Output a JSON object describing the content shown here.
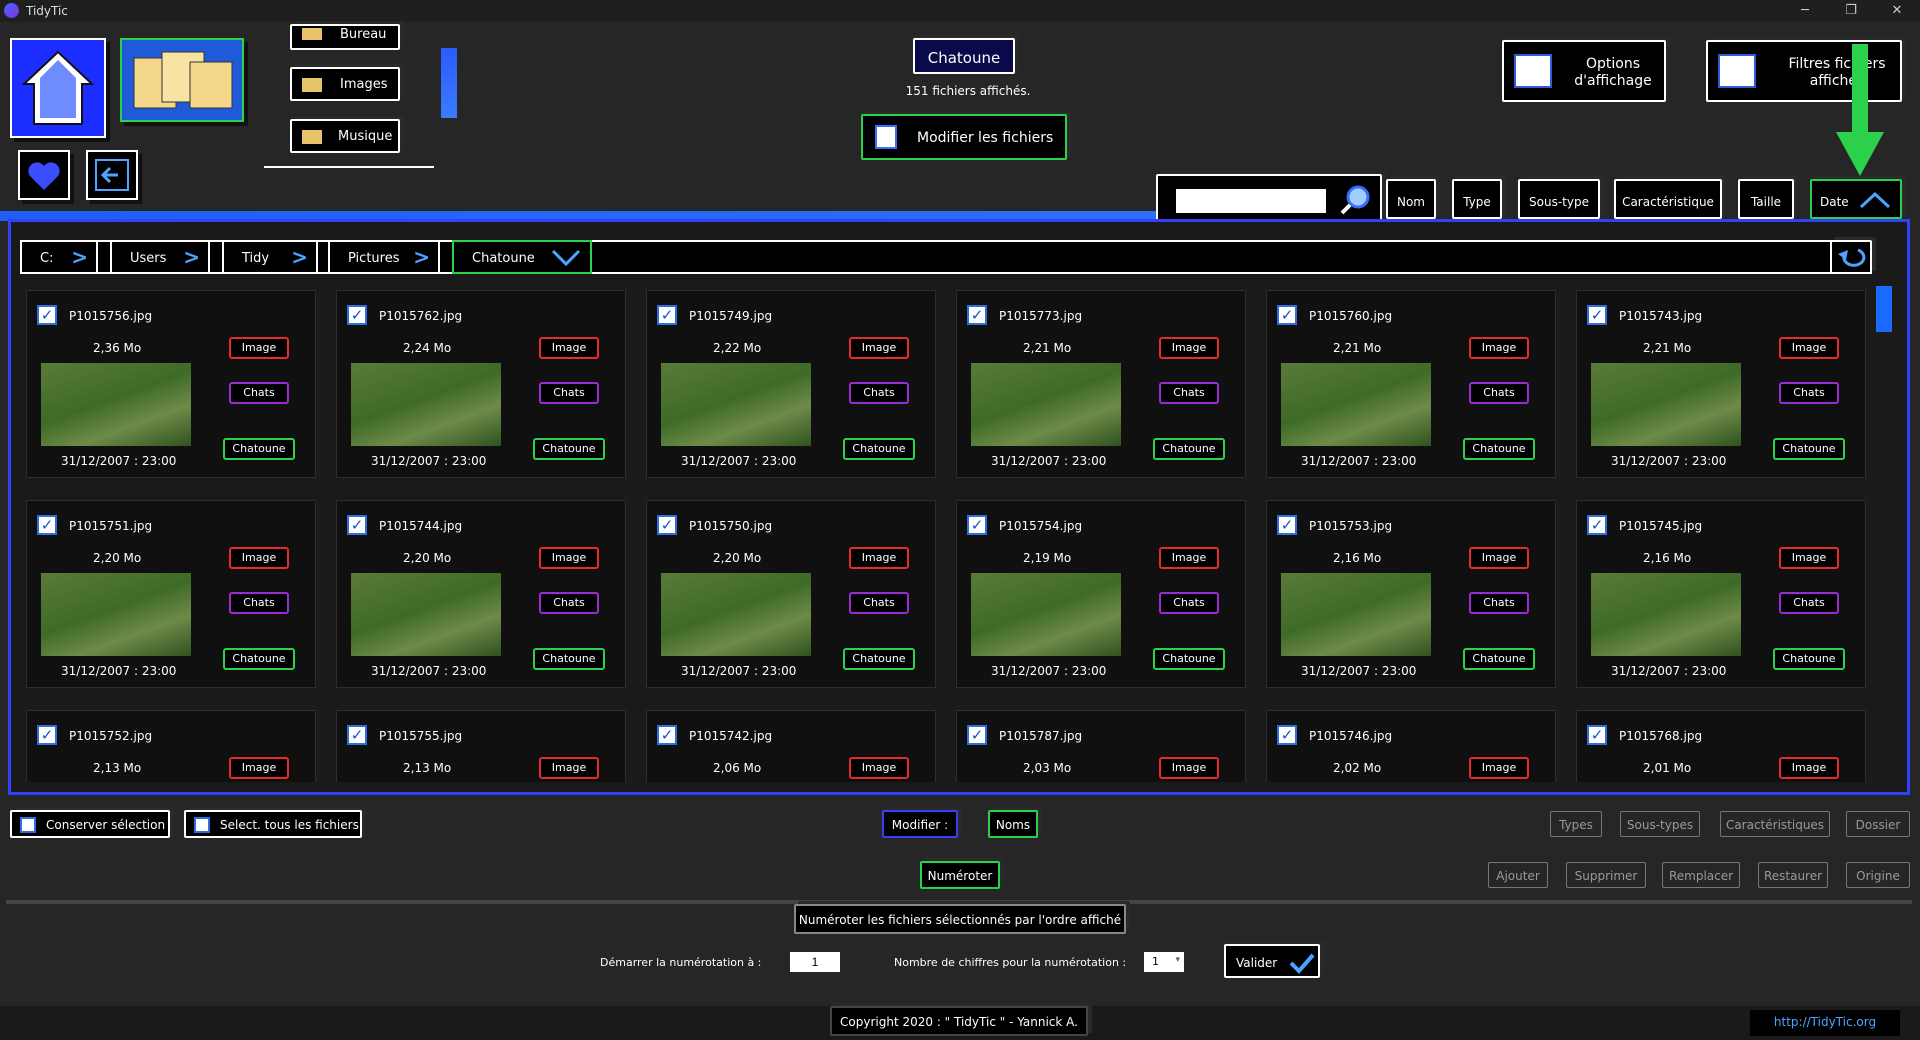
{
  "app": {
    "title": "TidyTic",
    "win_min": "─",
    "win_max": "❐",
    "win_close": "✕"
  },
  "favorites": [
    "Bureau",
    "Images",
    "Musique"
  ],
  "current": {
    "name": "Chatoune",
    "count_text": "151 fichiers affichés.",
    "modify_label": "Modifier les fichiers"
  },
  "options": {
    "display": "Options d'affichage",
    "filters": "Filtres fichiers affichés"
  },
  "sort": {
    "search_value": "",
    "labels": [
      "Nom",
      "Type",
      "Sous-type",
      "Caractéristique",
      "Taille",
      "Date"
    ]
  },
  "breadcrumb": [
    "C:",
    "Users",
    "Tidy",
    "Pictures",
    "Chatoune"
  ],
  "files": [
    {
      "name": "P1015756.jpg",
      "size": "2,36 Mo",
      "date": "31/12/2007 : 23:00",
      "type": "Image",
      "sub": "Chats",
      "char": "Chatoune"
    },
    {
      "name": "P1015762.jpg",
      "size": "2,24 Mo",
      "date": "31/12/2007 : 23:00",
      "type": "Image",
      "sub": "Chats",
      "char": "Chatoune"
    },
    {
      "name": "P1015749.jpg",
      "size": "2,22 Mo",
      "date": "31/12/2007 : 23:00",
      "type": "Image",
      "sub": "Chats",
      "char": "Chatoune"
    },
    {
      "name": "P1015773.jpg",
      "size": "2,21 Mo",
      "date": "31/12/2007 : 23:00",
      "type": "Image",
      "sub": "Chats",
      "char": "Chatoune"
    },
    {
      "name": "P1015760.jpg",
      "size": "2,21 Mo",
      "date": "31/12/2007 : 23:00",
      "type": "Image",
      "sub": "Chats",
      "char": "Chatoune"
    },
    {
      "name": "P1015743.jpg",
      "size": "2,21 Mo",
      "date": "31/12/2007 : 23:00",
      "type": "Image",
      "sub": "Chats",
      "char": "Chatoune"
    },
    {
      "name": "P1015751.jpg",
      "size": "2,20 Mo",
      "date": "31/12/2007 : 23:00",
      "type": "Image",
      "sub": "Chats",
      "char": "Chatoune"
    },
    {
      "name": "P1015744.jpg",
      "size": "2,20 Mo",
      "date": "31/12/2007 : 23:00",
      "type": "Image",
      "sub": "Chats",
      "char": "Chatoune"
    },
    {
      "name": "P1015750.jpg",
      "size": "2,20 Mo",
      "date": "31/12/2007 : 23:00",
      "type": "Image",
      "sub": "Chats",
      "char": "Chatoune"
    },
    {
      "name": "P1015754.jpg",
      "size": "2,19 Mo",
      "date": "31/12/2007 : 23:00",
      "type": "Image",
      "sub": "Chats",
      "char": "Chatoune"
    },
    {
      "name": "P1015753.jpg",
      "size": "2,16 Mo",
      "date": "31/12/2007 : 23:00",
      "type": "Image",
      "sub": "Chats",
      "char": "Chatoune"
    },
    {
      "name": "P1015745.jpg",
      "size": "2,16 Mo",
      "date": "31/12/2007 : 23:00",
      "type": "Image",
      "sub": "Chats",
      "char": "Chatoune"
    },
    {
      "name": "P1015752.jpg",
      "size": "2,13 Mo",
      "date": "",
      "type": "Image",
      "sub": "",
      "char": ""
    },
    {
      "name": "P1015755.jpg",
      "size": "2,13 Mo",
      "date": "",
      "type": "Image",
      "sub": "",
      "char": ""
    },
    {
      "name": "P1015742.jpg",
      "size": "2,06 Mo",
      "date": "",
      "type": "Image",
      "sub": "",
      "char": ""
    },
    {
      "name": "P1015787.jpg",
      "size": "2,03 Mo",
      "date": "",
      "type": "Image",
      "sub": "",
      "char": ""
    },
    {
      "name": "P1015746.jpg",
      "size": "2,02 Mo",
      "date": "",
      "type": "Image",
      "sub": "",
      "char": ""
    },
    {
      "name": "P1015768.jpg",
      "size": "2,01 Mo",
      "date": "",
      "type": "Image",
      "sub": "",
      "char": ""
    }
  ],
  "bottom": {
    "keep_selection": "Conserver sélection",
    "select_all": "Select. tous les fichiers",
    "modify": "Modifier :",
    "names": "Noms",
    "types": "Types",
    "subtypes": "Sous-types",
    "characteristics": "Caractéristiques",
    "folder": "Dossier",
    "number": "Numéroter",
    "add": "Ajouter",
    "delete": "Supprimer",
    "replace": "Remplacer",
    "restore": "Restaurer",
    "origin": "Origine",
    "number_desc": "Numéroter les fichiers sélectionnés par l'ordre affiché",
    "start_label": "Démarrer la numérotation à :",
    "start_value": "1",
    "digits_label": "Nombre de chiffres pour la numérotation :",
    "digits_value": "1",
    "validate": "Valider"
  },
  "footer": {
    "copyright": "Copyright 2020 : \" TidyTic \" - Yannick A.",
    "link": "http://TidyTic.org"
  }
}
